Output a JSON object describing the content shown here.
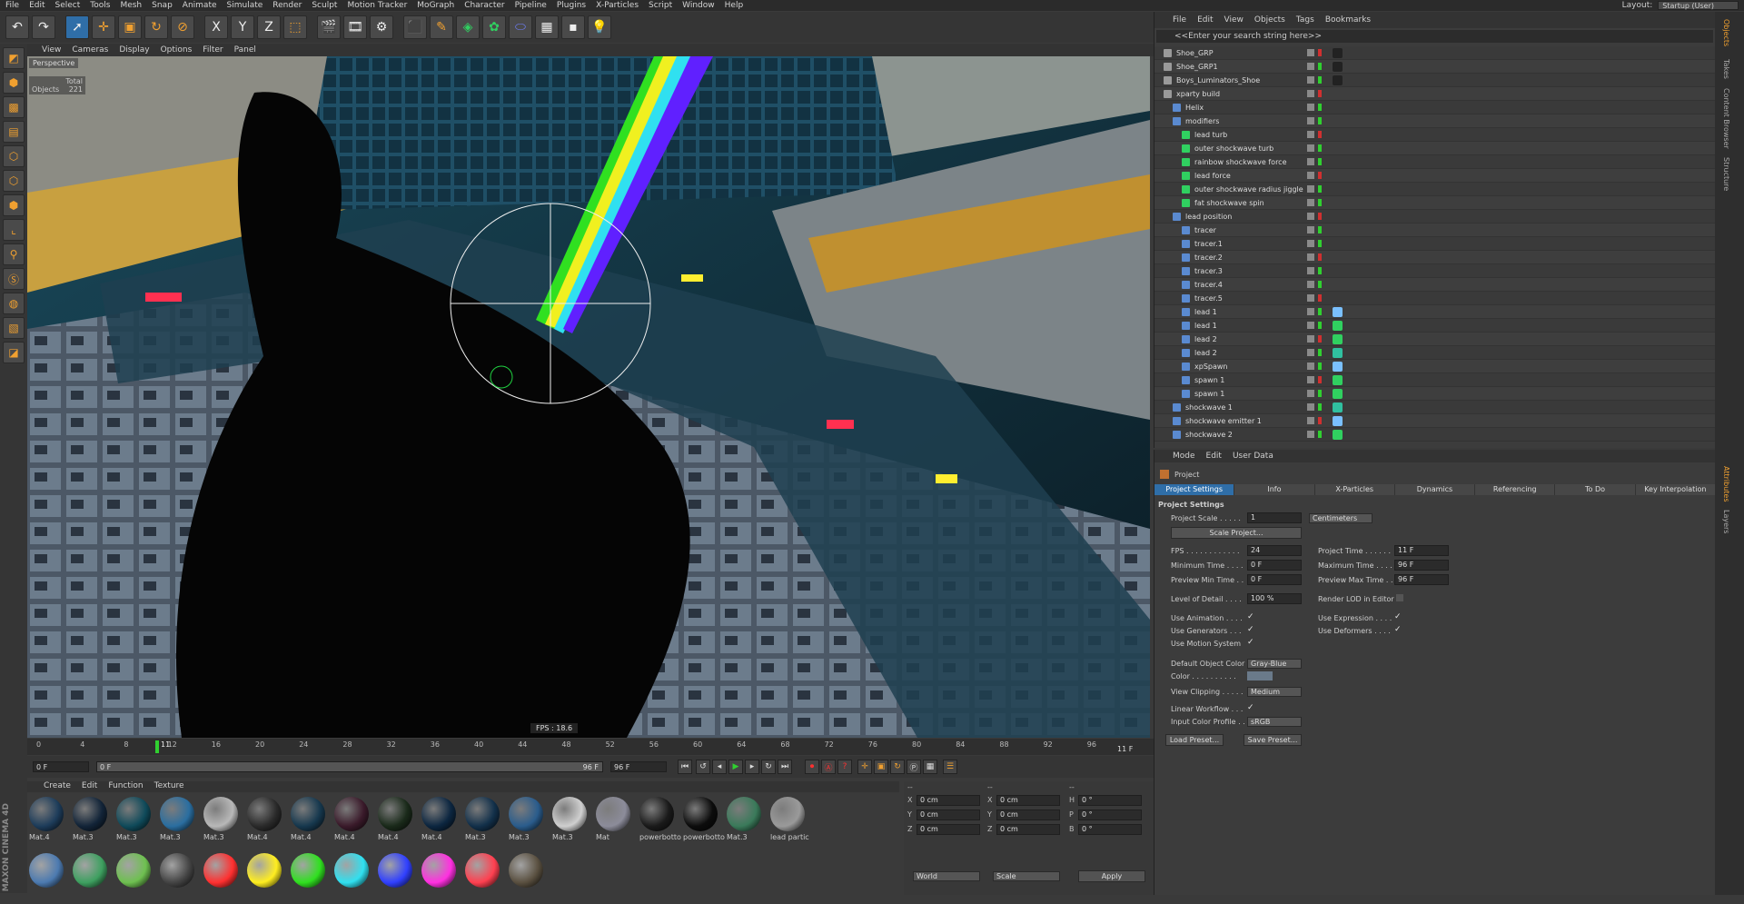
{
  "menu": [
    "File",
    "Edit",
    "Select",
    "Tools",
    "Mesh",
    "Snap",
    "Animate",
    "Simulate",
    "Render",
    "Sculpt",
    "Motion Tracker",
    "MoGraph",
    "Character",
    "Pipeline",
    "Plugins",
    "X-Particles",
    "Script",
    "Window",
    "Help"
  ],
  "layout": {
    "label": "Layout:",
    "value": "Startup (User)"
  },
  "toolbar_axes": [
    "X",
    "Y",
    "Z"
  ],
  "viewport": {
    "menu": [
      "View",
      "Cameras",
      "Display",
      "Options",
      "Filter",
      "Panel"
    ],
    "label": "Perspective",
    "stats_label": "Total",
    "stats_objects": "Objects",
    "stats_count": "221",
    "fps": "FPS : 18.6"
  },
  "timeline": {
    "ticks": [
      "0",
      "4",
      "8",
      "12",
      "16",
      "20",
      "24",
      "28",
      "32",
      "36",
      "40",
      "44",
      "48",
      "52",
      "56",
      "60",
      "64",
      "68",
      "72",
      "76",
      "80",
      "84",
      "88",
      "92",
      "96"
    ],
    "current": "11",
    "current_frame_label": "11 F",
    "start_field": "0 F",
    "range_start": "0 F",
    "range_end": "96 F",
    "end_field": "96 F"
  },
  "materials": {
    "menu": [
      "Create",
      "Edit",
      "Function",
      "Texture"
    ],
    "row1": [
      {
        "label": "Mat.4",
        "color": "#1d3c5a"
      },
      {
        "label": "Mat.3",
        "color": "#122438"
      },
      {
        "label": "Mat.3",
        "color": "#0f4a5a"
      },
      {
        "label": "Mat.3",
        "color": "#2a6ea0"
      },
      {
        "label": "Mat.3",
        "color": "#b8b8b8"
      },
      {
        "label": "Mat.4",
        "color": "#2a2a2a"
      },
      {
        "label": "Mat.4",
        "color": "#16384e"
      },
      {
        "label": "Mat.4",
        "color": "#3a1a2a"
      },
      {
        "label": "Mat.4",
        "color": "#1a2a1a"
      },
      {
        "label": "Mat.4",
        "color": "#0c2640"
      },
      {
        "label": "Mat.3",
        "color": "#12304a"
      },
      {
        "label": "Mat.3",
        "color": "#2a5c8c"
      },
      {
        "label": "Mat.3",
        "color": "#cfcfcf"
      },
      {
        "label": "Mat",
        "color": "#8c8c9a"
      },
      {
        "label": "powerbotto",
        "color": "#1a1a1a"
      },
      {
        "label": "powerbotto",
        "color": "#0c0c0c"
      },
      {
        "label": "Mat.3",
        "color": "#3a7a5a"
      },
      {
        "label": "lead partic",
        "color": "#9a9a9a"
      }
    ],
    "row2": [
      {
        "color": "#4c7ab0"
      },
      {
        "color": "#3ea060"
      },
      {
        "color": "#6ec050"
      },
      {
        "color": "#444444"
      },
      {
        "color": "#ff3030"
      },
      {
        "color": "#ffee20"
      },
      {
        "color": "#30e020"
      },
      {
        "color": "#30e0f0"
      },
      {
        "color": "#3040ff"
      },
      {
        "color": "#ff30e0"
      },
      {
        "color": "#ff4050"
      },
      {
        "color": "#5a5040"
      }
    ]
  },
  "coords": {
    "header": "--",
    "rows": [
      {
        "a": "X",
        "av": "0 cm",
        "b": "X",
        "bv": "0 cm",
        "c": "H",
        "cv": "0 °"
      },
      {
        "a": "Y",
        "av": "0 cm",
        "b": "Y",
        "bv": "0 cm",
        "c": "P",
        "cv": "0 °"
      },
      {
        "a": "Z",
        "av": "0 cm",
        "b": "Z",
        "bv": "0 cm",
        "c": "B",
        "cv": "0 °"
      }
    ],
    "world": "World",
    "scale": "Scale",
    "apply": "Apply"
  },
  "objects": {
    "menu": [
      "File",
      "Edit",
      "View",
      "Objects",
      "Tags",
      "Bookmarks"
    ],
    "search": "<<Enter your search string here>>",
    "rows": [
      {
        "name": "Shoe_GRP",
        "indent": 0
      },
      {
        "name": "Shoe_GRP1",
        "indent": 0
      },
      {
        "name": "Boys_Luminators_Shoe",
        "indent": 0
      },
      {
        "name": "xparty build",
        "indent": 0
      },
      {
        "name": "Helix",
        "indent": 1
      },
      {
        "name": "modifiers",
        "indent": 1
      },
      {
        "name": "lead turb",
        "indent": 2
      },
      {
        "name": "outer shockwave turb",
        "indent": 2
      },
      {
        "name": "rainbow shockwave force",
        "indent": 2
      },
      {
        "name": "lead force",
        "indent": 2
      },
      {
        "name": "outer shockwave radius jiggle",
        "indent": 2
      },
      {
        "name": "fat shockwave spin",
        "indent": 2
      },
      {
        "name": "lead position",
        "indent": 1
      },
      {
        "name": "tracer",
        "indent": 2
      },
      {
        "name": "tracer.1",
        "indent": 2
      },
      {
        "name": "tracer.2",
        "indent": 2
      },
      {
        "name": "tracer.3",
        "indent": 2
      },
      {
        "name": "tracer.4",
        "indent": 2
      },
      {
        "name": "tracer.5",
        "indent": 2
      },
      {
        "name": "lead 1",
        "indent": 2
      },
      {
        "name": "lead 1",
        "indent": 2
      },
      {
        "name": "lead 2",
        "indent": 2
      },
      {
        "name": "lead 2",
        "indent": 2
      },
      {
        "name": "xpSpawn",
        "indent": 2
      },
      {
        "name": "spawn 1",
        "indent": 2
      },
      {
        "name": "spawn 1",
        "indent": 2
      },
      {
        "name": "shockwave 1",
        "indent": 1
      },
      {
        "name": "shockwave emitter 1",
        "indent": 1
      },
      {
        "name": "shockwave 2",
        "indent": 1
      }
    ]
  },
  "attributes": {
    "menu": [
      "Mode",
      "Edit",
      "User Data"
    ],
    "title": "Project",
    "tabs": [
      "Project Settings",
      "Info",
      "X-Particles",
      "Dynamics",
      "Referencing",
      "To Do",
      "Key Interpolation"
    ],
    "section": "Project Settings",
    "project_scale_label": "Project Scale . . . . .",
    "project_scale": "1",
    "scale_unit": "Centimeters",
    "scale_project_btn": "Scale Project...",
    "fps_label": "FPS . . . . . . . . . . . .",
    "fps": "24",
    "min_time_label": "Minimum Time . . . .",
    "min_time": "0 F",
    "preview_min_label": "Preview Min Time . .",
    "preview_min": "0 F",
    "project_time_label": "Project Time . . . . . .",
    "project_time": "11 F",
    "max_time_label": "Maximum Time . . . .",
    "max_time": "96 F",
    "preview_max_label": "Preview Max Time . .",
    "preview_max": "96 F",
    "lod_label": "Level of Detail . . . .",
    "lod": "100 %",
    "render_lod_label": "Render LOD in Editor",
    "use_animation_label": "Use Animation . . . .",
    "use_generators_label": "Use Generators . . .",
    "use_motion_label": "Use Motion System",
    "use_expression_label": "Use Expression . . . .",
    "use_deformers_label": "Use Deformers . . . .",
    "default_color_label": "Default Object Color",
    "default_color": "Gray-Blue",
    "color_label": "Color . . . . . . . . . .",
    "view_clipping_label": "View Clipping . . . . .",
    "view_clipping": "Medium",
    "linear_workflow_label": "Linear Workflow . . .",
    "input_profile_label": "Input Color Profile . .",
    "input_profile": "sRGB",
    "load_preset": "Load Preset...",
    "save_preset": "Save Preset..."
  },
  "side_tabs": [
    "Objects",
    "Takes",
    "Content Browser",
    "Structure",
    "Attributes",
    "Layers"
  ],
  "brand": "MAXON CINEMA 4D"
}
